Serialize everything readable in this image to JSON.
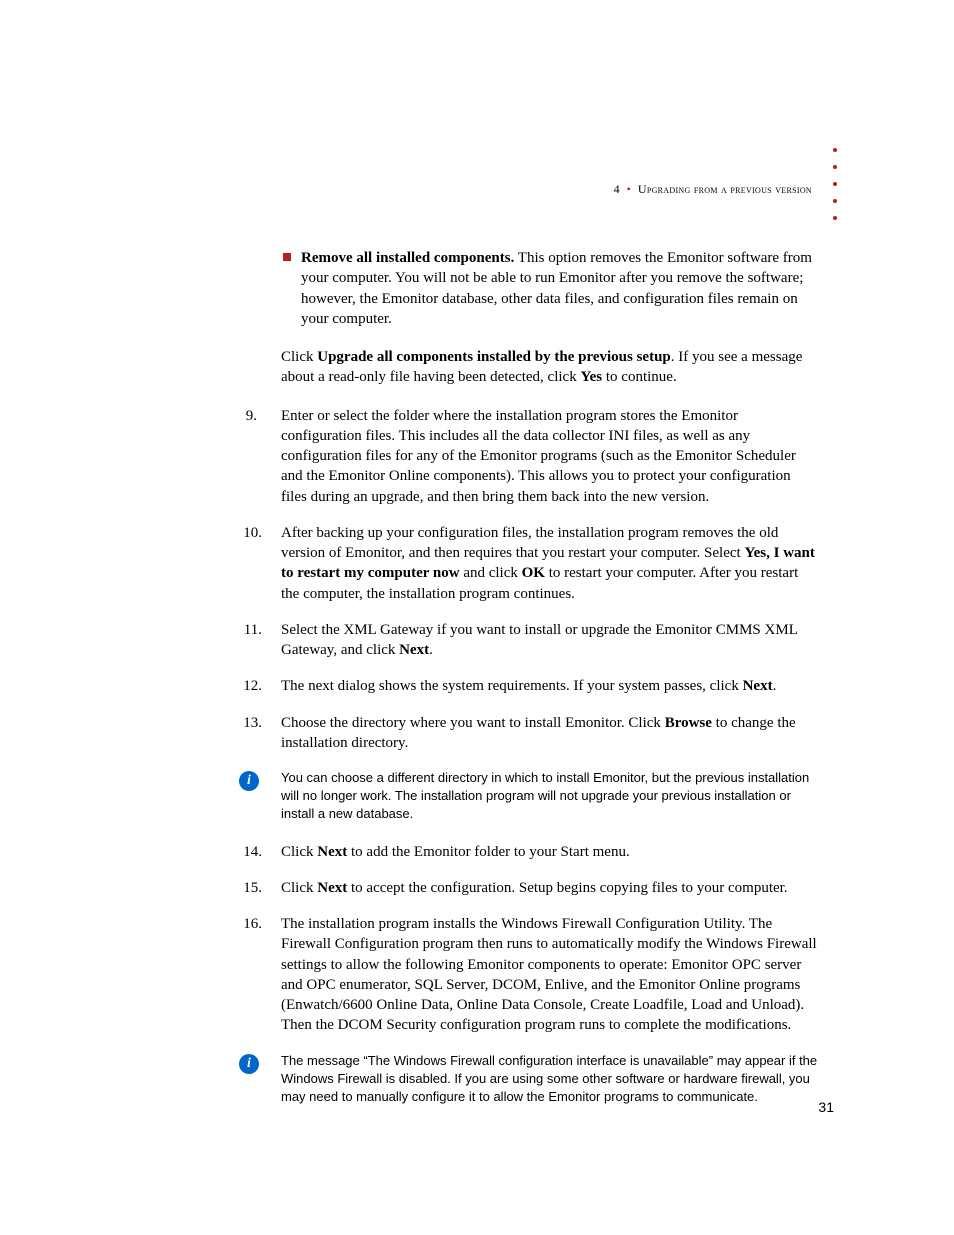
{
  "header": {
    "chapter_number": "4",
    "chapter_title": "Upgrading from a previous version"
  },
  "bullet_item": {
    "lead_bold": "Remove all installed components.",
    "text_after": " This option removes the Emonitor software from your computer. You will not be able to run Emonitor after you remove the software; however, the Emonitor database, other data files, and configuration files remain on your computer."
  },
  "click_para": {
    "t1": "Click ",
    "b1": "Upgrade all components installed by the previous setup",
    "t2": ". If you see a message about a read-only file having been detected, click ",
    "b2": "Yes",
    "t3": " to continue."
  },
  "steps": {
    "s9": "Enter or select the folder where the installation program stores the Emonitor configuration files. This includes all the data collector INI files, as well as any configuration files for any of the Emonitor programs (such as the Emonitor Scheduler and the Emonitor Online components). This allows you to protect your configuration files during an upgrade, and then bring them back into the new version.",
    "s10": {
      "t1": "After backing up your configuration files, the installation program removes the old version of Emonitor, and then requires that you restart your computer. Select ",
      "b1": "Yes, I want to restart my computer now",
      "t2": " and click ",
      "b2": "OK",
      "t3": " to restart your computer. After you restart the computer, the installation program continues."
    },
    "s11": {
      "t1": "Select the XML Gateway if you want to install or upgrade the Emonitor CMMS XML Gateway, and click ",
      "b1": "Next",
      "t2": "."
    },
    "s12": {
      "t1": "The next dialog shows the system requirements. If your system passes, click ",
      "b1": "Next",
      "t2": "."
    },
    "s13": {
      "t1": "Choose the directory where you want to install Emonitor. Click ",
      "b1": "Browse",
      "t2": " to change the installation directory."
    },
    "s14": {
      "t1": "Click ",
      "b1": "Next",
      "t2": " to add the Emonitor folder to your Start menu."
    },
    "s15": {
      "t1": "Click ",
      "b1": "Next",
      "t2": " to accept the configuration. Setup begins copying files to your computer."
    },
    "s16": "The installation program installs the Windows Firewall Configuration Utility. The Firewall Configuration program then runs to automatically modify the Windows Firewall settings to allow the following Emonitor components to operate: Emonitor OPC server and OPC enumerator, SQL Server, DCOM, Enlive, and the Emonitor Online programs (Enwatch/6600 Online Data, Online Data Console, Create Loadfile, Load and Unload). Then the DCOM Security configuration program runs to complete the modifications."
  },
  "note1": "You can choose a different directory in which to install Emonitor, but the previous installation will no longer work. The installation program will not upgrade your previous installation or install a new database.",
  "note2": "The message “The Windows Firewall configuration interface is unavailable” may appear if the Windows Firewall is disabled. If you are using some other software or hardware firewall, you may need to manually configure it to allow the Emonitor programs to communicate.",
  "page_number": "31"
}
